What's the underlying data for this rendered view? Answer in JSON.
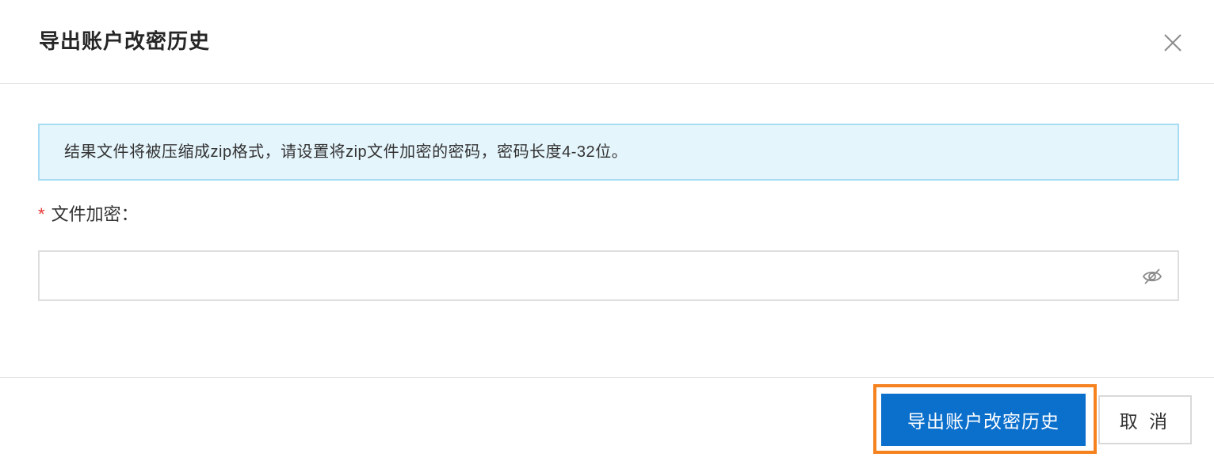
{
  "dialog": {
    "title": "导出账户改密历史",
    "close_icon": "close-icon"
  },
  "alert": {
    "message": "结果文件将被压缩成zip格式，请设置将zip文件加密的密码，密码长度4-32位。",
    "background": "#e5f5fc",
    "border": "#a6dbf3"
  },
  "form": {
    "password_field": {
      "required_mark": "*",
      "label": "文件加密：",
      "value": "",
      "placeholder": "",
      "toggle_icon": "eye-off-icon"
    }
  },
  "footer": {
    "primary_label": "导出账户改密历史",
    "cancel_label": "取 消"
  },
  "colors": {
    "primary": "#0b6fcc",
    "highlight": "#f5821f",
    "required": "#e53935"
  }
}
